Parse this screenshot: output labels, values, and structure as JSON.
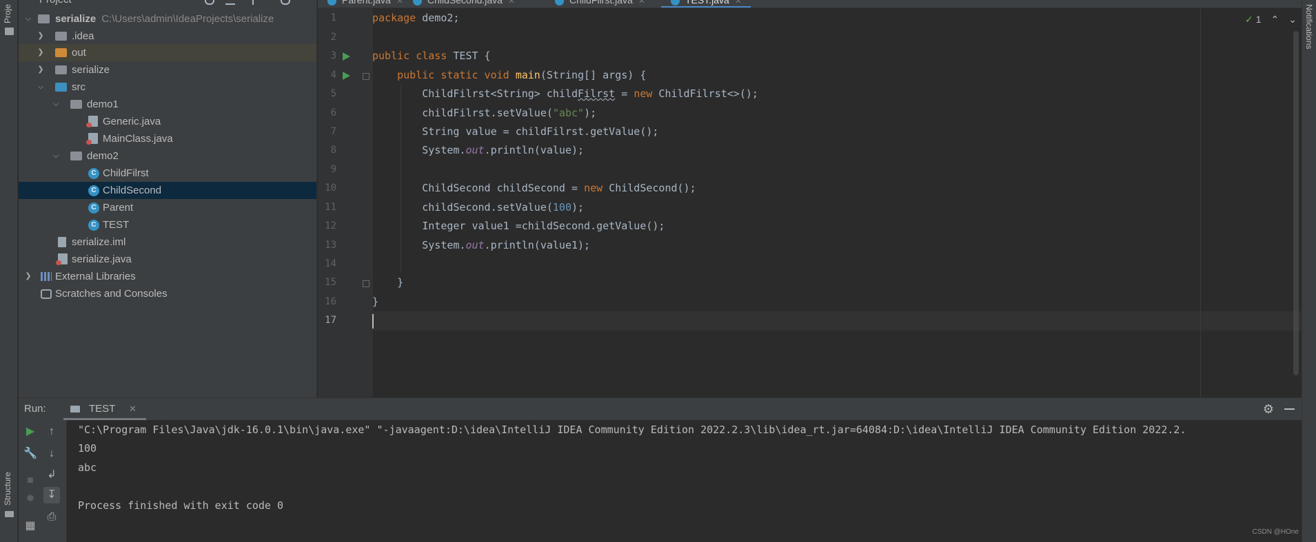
{
  "window": {
    "left_strip": {
      "project_label": "Proje",
      "structure_label": "Structure"
    },
    "right_strip": {
      "notifications_label": "Notifications"
    }
  },
  "project_panel": {
    "header": "Project",
    "tree": [
      {
        "label": "serialize",
        "path": "C:\\Users\\admin\\IdeaProjects\\serialize",
        "type": "module",
        "expanded": true
      },
      {
        "label": ".idea",
        "type": "folder",
        "expanded": false
      },
      {
        "label": "out",
        "type": "folder-excluded",
        "expanded": false
      },
      {
        "label": "serialize",
        "type": "folder",
        "expanded": false
      },
      {
        "label": "src",
        "type": "source-root",
        "expanded": true
      },
      {
        "label": "demo1",
        "type": "package",
        "expanded": true
      },
      {
        "label": "Generic.java",
        "type": "java-file"
      },
      {
        "label": "MainClass.java",
        "type": "java-file"
      },
      {
        "label": "demo2",
        "type": "package",
        "expanded": true
      },
      {
        "label": "ChildFilrst",
        "type": "class"
      },
      {
        "label": "ChildSecond",
        "type": "class",
        "selected": true
      },
      {
        "label": "Parent",
        "type": "class"
      },
      {
        "label": "TEST",
        "type": "class-runnable"
      },
      {
        "label": "serialize.iml",
        "type": "iml-file"
      },
      {
        "label": "serialize.java",
        "type": "java-file"
      },
      {
        "label": "External Libraries",
        "type": "libraries",
        "expanded": false
      },
      {
        "label": "Scratches and Consoles",
        "type": "scratches"
      }
    ]
  },
  "editor_tabs": [
    {
      "label": "Parent.java"
    },
    {
      "label": "ChildSecond.java"
    },
    {
      "label": "ChildFilrst.java"
    },
    {
      "label": "TEST.java",
      "active": true
    }
  ],
  "editor": {
    "inspection_count": "1",
    "current_line": 17,
    "line_numbers": [
      "1",
      "2",
      "3",
      "4",
      "5",
      "6",
      "7",
      "8",
      "9",
      "10",
      "11",
      "12",
      "13",
      "14",
      "15",
      "16",
      "17"
    ],
    "code": {
      "l1_kw": "package",
      "l1_rest": " demo2;",
      "l3_kw": "public class",
      "l3_rest": " TEST {",
      "l4_kw": "public static void",
      "l4_fn": "main",
      "l4_rest": "(String[] args) {",
      "l5_a": "ChildFilrst<String> child",
      "l5_b": "Filrst",
      "l5_c": " = ",
      "l5_kw": "new",
      "l5_d": " ChildFilrst<>();",
      "l6_a": "childFilrst.setValue(",
      "l6_str": "\"abc\"",
      "l6_b": ");",
      "l7": "String value = childFilrst.getValue();",
      "l8_a": "System.",
      "l8_static": "out",
      "l8_b": ".println(value);",
      "l10_a": "ChildSecond childSecond = ",
      "l10_kw": "new",
      "l10_b": " ChildSecond();",
      "l11_a": "childSecond.setValue(",
      "l11_num": "100",
      "l11_b": ");",
      "l12": "Integer value1 =childSecond.getValue();",
      "l13_a": "System.",
      "l13_static": "out",
      "l13_b": ".println(value1);",
      "l15": "}",
      "l16": "}"
    }
  },
  "run_panel": {
    "title": "Run:",
    "tab_label": "TEST",
    "console_lines": [
      "\"C:\\Program Files\\Java\\jdk-16.0.1\\bin\\java.exe\" \"-javaagent:D:\\idea\\IntelliJ IDEA Community Edition 2022.2.3\\lib\\idea_rt.jar=64084:D:\\idea\\IntelliJ IDEA Community Edition 2022.2.",
      "100",
      "abc",
      "",
      "Process finished with exit code 0"
    ]
  },
  "watermark": "CSDN @HOne",
  "colors": {
    "keyword": "#cc7832",
    "method": "#ffc66d",
    "string": "#6a8759",
    "number": "#6897bb",
    "static_field": "#9876aa",
    "selection": "#0d293e",
    "accent": "#4a88c7",
    "run_green": "#499c54"
  }
}
